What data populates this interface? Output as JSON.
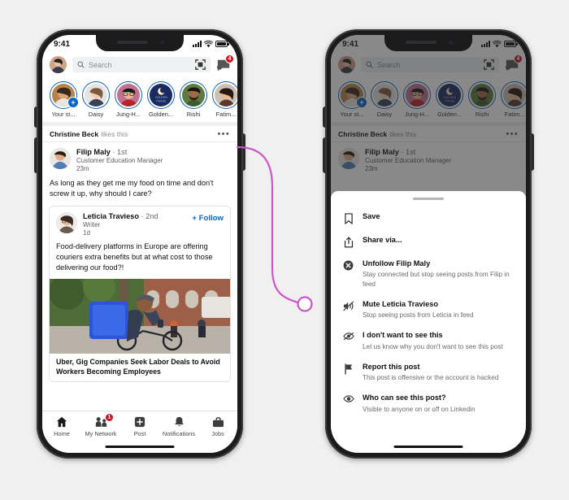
{
  "colors": {
    "background": "#f0f0f0",
    "brand_blue": "#0a66c2",
    "badge_red": "#d11124",
    "connector_pink": "#cc55cc",
    "overlay_dim": "rgba(40,40,40,0.55)"
  },
  "status_bar": {
    "time": "9:41",
    "signal_icon": "cellular-bars-icon",
    "wifi_icon": "wifi-icon",
    "battery_icon": "battery-icon"
  },
  "header": {
    "avatar_name": "profile-avatar",
    "search_placeholder": "Search",
    "search_icon": "search-icon",
    "qr_icon": "qr-scanner-icon",
    "messaging_icon": "messaging-icon",
    "messaging_badge": "4"
  },
  "stories": [
    {
      "label": "Your st...",
      "has_add": true
    },
    {
      "label": "Daisy",
      "has_add": false
    },
    {
      "label": "Jung-H...",
      "has_add": false
    },
    {
      "label": "Golden...",
      "has_add": false
    },
    {
      "label": "Rishi",
      "has_add": false
    },
    {
      "label": "Fatim...",
      "has_add": false
    }
  ],
  "feed": {
    "social_proof_name": "Christine Beck",
    "social_proof_action": "likes this",
    "overflow_icon": "ellipsis-menu-icon",
    "post": {
      "author": "Filip Maly",
      "degree": "· 1st",
      "headline": "Customer Education Manager",
      "time": "23m",
      "text": "As long as they get me my food on time and don't screw it up, why should I care?"
    },
    "reshare": {
      "author": "Leticia Travieso",
      "degree": "· 2nd",
      "headline": "Writer",
      "time": "1d",
      "follow_label": "+ Follow",
      "text": "Food-delivery platforms in Europe are offering couriers extra benefits but at what cost to those delivering our food?!",
      "image_alt": "courier-with-blue-delivery-backpack-photo",
      "article_title": "Uber, Gig Companies Seek Labor Deals to Avoid Workers Becoming Employees"
    }
  },
  "tabbar": [
    {
      "label": "Home",
      "icon": "home-icon",
      "badge": ""
    },
    {
      "label": "My Network",
      "icon": "my-network-icon",
      "badge": "1"
    },
    {
      "label": "Post",
      "icon": "post-plus-icon",
      "badge": ""
    },
    {
      "label": "Notifications",
      "icon": "bell-icon",
      "badge": ""
    },
    {
      "label": "Jobs",
      "icon": "briefcase-icon",
      "badge": ""
    }
  ],
  "menu_sheet": {
    "grab_handle": "sheet-grab-handle",
    "items": [
      {
        "title": "Save",
        "subtitle": "",
        "icon": "bookmark-icon"
      },
      {
        "title": "Share via...",
        "subtitle": "",
        "icon": "share-icon"
      },
      {
        "title": "Unfollow Filip Maly",
        "subtitle": "Stay connected but stop seeing posts from Filip in feed",
        "icon": "x-circle-icon"
      },
      {
        "title": "Mute Leticia Travieso",
        "subtitle": "Stop seeing posts from Leticia in feed",
        "icon": "mute-speaker-icon"
      },
      {
        "title": "I don't want to see this",
        "subtitle": "Let us know why you don't want to see this post",
        "icon": "eye-slash-icon"
      },
      {
        "title": "Report this post",
        "subtitle": "This post is offensive or the account is hacked",
        "icon": "flag-icon"
      },
      {
        "title": "Who can see this post?",
        "subtitle": "Visible to anyone on or off on Linkedin",
        "icon": "eye-icon"
      }
    ]
  }
}
